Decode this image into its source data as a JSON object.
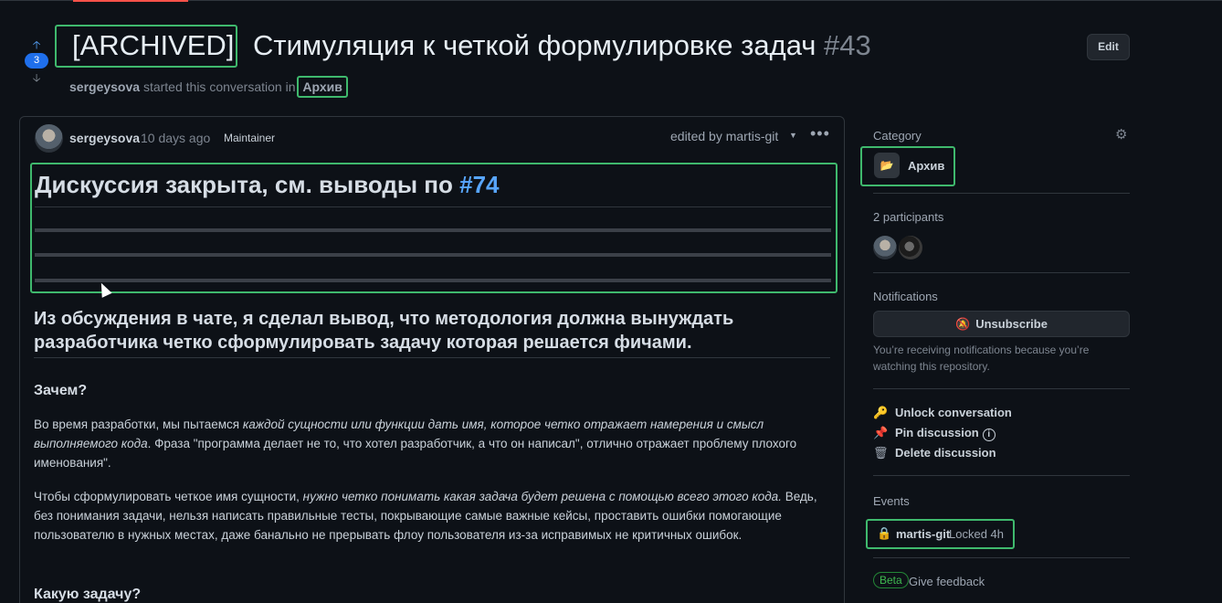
{
  "header": {
    "title_prefix": "[ARCHIVED]",
    "title_main": " Стимуляция к четкой формулировке задач ",
    "number": "#43",
    "vote_count": "3",
    "edit_label": "Edit",
    "starter": "sergeysova",
    "started_text": " started this conversation in ",
    "category": "Архив"
  },
  "post": {
    "author": "sergeysova",
    "ago": "10 days ago",
    "role": "Maintainer",
    "edited": "edited by martis-git",
    "heading_text": "Дискуссия закрыта, см. выводы по ",
    "heading_link": "#74",
    "h2": "Из обсуждения в чате, я сделал вывод, что методология должна вынуждать разработчика четко сформулировать задачу которая решается фичами.",
    "h3_why": "Зачем?",
    "p1_a": "Во время разработки, мы пытаемся ",
    "p1_i": "каждой сущности или функции дать имя, которое четко отражает намерения и смысл выполняемого кода",
    "p1_b": ". Фраза \"программа делает не то, что хотел разработчик, а что он написал\", отлично отражает проблему плохого именования\".",
    "p2_a": "Чтобы сформулировать четкое имя сущности, ",
    "p2_i": "нужно четко понимать какая задача будет решена с помощью всего этого кода.",
    "p2_b": " Ведь, без понимания задачи, нельзя написать правильные тесты, покрывающие самые важные кейсы, проставить ошибки помогающие пользователю в нужных местах, даже банально не прерывать флоу пользователя из-за исправимых не критичных ошибок.",
    "h3_what": "Какую задачу?"
  },
  "sidebar": {
    "category_label": "Category",
    "category_value": "Архив",
    "participants_label": "2 participants",
    "notifications_label": "Notifications",
    "unsubscribe": "Unsubscribe",
    "notif_note": "You’re receiving notifications because you’re watching this repository.",
    "unlock": "Unlock conversation",
    "pin": "Pin discussion",
    "delete": "Delete discussion",
    "events_label": "Events",
    "event_user": "martis-git",
    "event_text": "Locked 4h",
    "beta": "Beta",
    "feedback": "Give feedback"
  }
}
